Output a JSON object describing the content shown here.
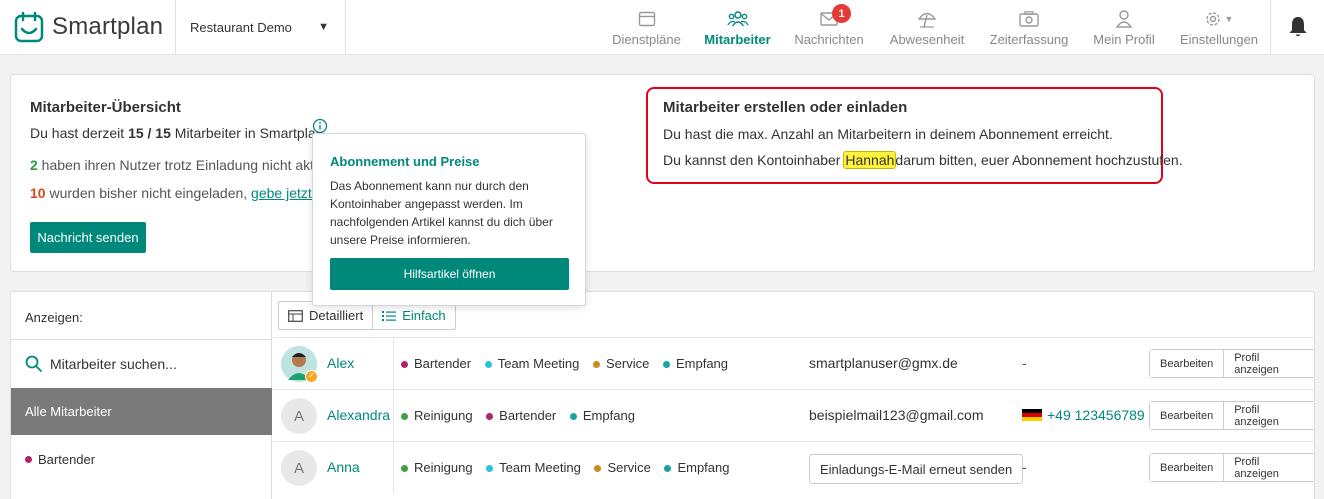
{
  "app": {
    "name": "Smartplan"
  },
  "company": {
    "name": "Restaurant Demo"
  },
  "nav": [
    {
      "label": "Dienstpläne",
      "icon": "calendar-icon"
    },
    {
      "label": "Mitarbeiter",
      "icon": "people-icon",
      "active": true
    },
    {
      "label": "Nachrichten",
      "icon": "mail-icon",
      "badge": "1"
    },
    {
      "label": "Abwesenheit",
      "icon": "umbrella-icon"
    },
    {
      "label": "Zeiterfassung",
      "icon": "camera-icon"
    },
    {
      "label": "Mein Profil",
      "icon": "user-icon"
    },
    {
      "label": "Einstellungen",
      "icon": "gear-icon"
    }
  ],
  "overview": {
    "title": "Mitarbeiter-Übersicht",
    "line1_pre": "Du hast derzeit ",
    "line1_count": "15 / 15",
    "line1_post": " Mitarbeiter in Smartplan.",
    "line2_count": "2",
    "line2_text": " haben ihren Nutzer trotz Einladung nicht aktivi",
    "line3_count": "10",
    "line3_text": " wurden bisher nicht eingeladen, ",
    "line3_link": "gebe jetzt ih",
    "send_button": "Nachricht senden"
  },
  "limit_box": {
    "title": "Mitarbeiter erstellen oder einladen",
    "line1": "Du hast die max. Anzahl an Mitarbeitern in deinem Abonnement erreicht.",
    "line2_pre": "Du kannst den Kontoinhaber ",
    "line2_name": "Hannah",
    "line2_post": "darum bitten, euer Abonnement hochzustufen."
  },
  "popover": {
    "title": "Abonnement und Preise",
    "body": "Das Abonnement kann nur durch den Kontoinhaber angepasst werden. Im nachfolgenden Artikel kannst du dich über unsere Preise informieren.",
    "button": "Hilfsartikel öffnen"
  },
  "sidebar": {
    "heading": "Anzeigen:",
    "search_placeholder": "Mitarbeiter suchen...",
    "all_label": "Alle Mitarbeiter",
    "group_label": "Bartender"
  },
  "view_toggle": {
    "detailed": "Detailliert",
    "simple": "Einfach"
  },
  "colors": {
    "accent": "#00897b",
    "bartender": "#b0246e",
    "team_meeting": "#26c6da",
    "service": "#c98b1a",
    "empfang": "#1aa3a3",
    "reinigung": "#43a047"
  },
  "employees": [
    {
      "name": "Alex",
      "avatar": "",
      "tags": [
        "Bartender",
        "Team Meeting",
        "Service",
        "Empfang"
      ],
      "email": "smartplanuser@gmx.de",
      "phone": "-",
      "actions": [
        "Bearbeiten",
        "Profil anzeigen"
      ]
    },
    {
      "name": "Alexandra",
      "avatar": "A",
      "tags": [
        "Reinigung",
        "Bartender",
        "Empfang"
      ],
      "email": "beispielmail123@gmail.com",
      "phone": "+49 123456789",
      "actions": [
        "Bearbeiten",
        "Profil anzeigen"
      ]
    },
    {
      "name": "Anna",
      "avatar": "A",
      "tags": [
        "Reinigung",
        "Team Meeting",
        "Service",
        "Empfang"
      ],
      "invite_button": "Einladungs-E-Mail erneut senden",
      "phone": "-",
      "actions": [
        "Bearbeiten",
        "Profil anzeigen"
      ]
    }
  ]
}
